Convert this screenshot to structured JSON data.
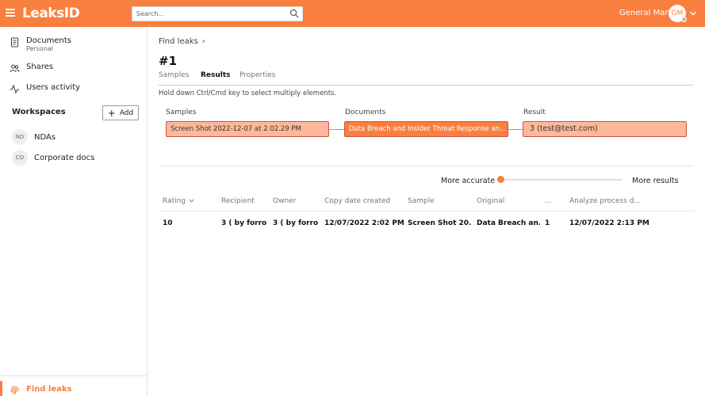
{
  "brand": {
    "logo": "LeaksID",
    "accent": "#f97f3f"
  },
  "header": {
    "search_placeholder": "Search...",
    "user_name": "General Mark",
    "avatar_initials": "GM"
  },
  "sidebar": {
    "items": [
      {
        "label": "Documents",
        "sublabel": "Personal",
        "icon": "document-icon"
      },
      {
        "label": "Shares",
        "icon": "users-icon"
      },
      {
        "label": "Users activity",
        "icon": "activity-icon"
      }
    ],
    "workspaces_title": "Workspaces",
    "add_label": "Add",
    "workspaces": [
      {
        "initials": "ND",
        "label": "NDAs"
      },
      {
        "initials": "CO",
        "label": "Corporate docs"
      }
    ],
    "footer_item": {
      "label": "Find leaks",
      "icon": "fingerprint-icon"
    }
  },
  "main": {
    "breadcrumb": "Find leaks",
    "title": "#1",
    "tabs": [
      "Samples",
      "Results",
      "Properties"
    ],
    "active_tab": "Results",
    "hint": "Hold down Ctrl/Cmd key to select multiply elements.",
    "flow": {
      "samples_label": "Samples",
      "documents_label": "Documents",
      "result_label": "Result",
      "sample_value": "Screen Shot 2022-12-07 at 2.02.29 PM",
      "document_value": "Data Breach and Insider Threat Response and...",
      "result_value": "3 (test@test.com)"
    },
    "slider": {
      "left_label": "More accurate",
      "right_label": "More results",
      "value": 0
    },
    "table": {
      "columns": [
        "Rating",
        "Recipient",
        "Owner",
        "Copy date created",
        "Sample",
        "Original",
        "...",
        "Analyze process d..."
      ],
      "rows": [
        [
          "10",
          "3 ( by forro...",
          "3 ( by forro...",
          "12/07/2022 2:02 PM",
          "Screen Shot 20...",
          "Data Breach an...",
          "1",
          "12/07/2022 2:13 PM"
        ]
      ]
    }
  }
}
